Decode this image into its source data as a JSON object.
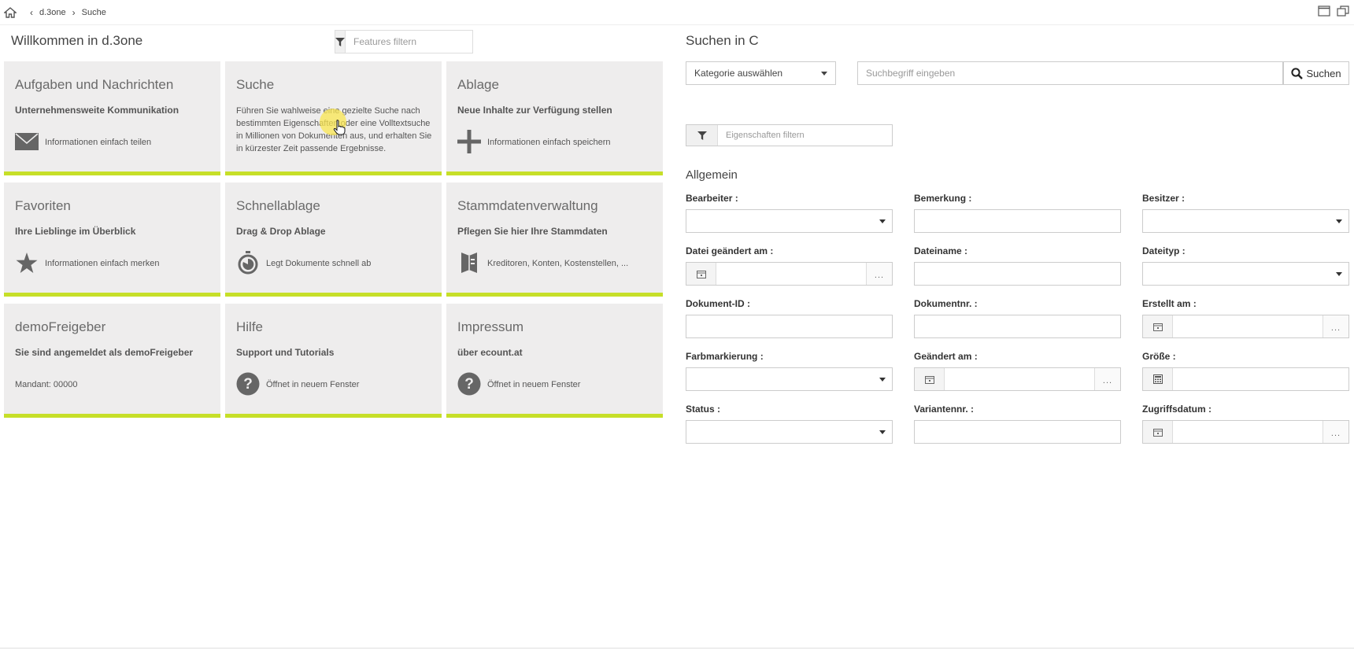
{
  "topbar": {
    "crumbs": [
      "d.3one",
      "Suche"
    ]
  },
  "left": {
    "title": "Willkommen in d.3one",
    "filter_placeholder": "Features filtern"
  },
  "tiles": [
    {
      "title": "Aufgaben und Nachrichten",
      "subtitle": "Unternehmensweite Kommunikation",
      "line": "Informationen einfach teilen",
      "icon": "envelope-icon"
    },
    {
      "title": "Suche",
      "desc": "Führen Sie wahlweise eine gezielte Suche nach bestimmten Eigenschaften oder eine Volltextsuche in Millionen von Dokumenten aus, und erhalten Sie in kürzester Zeit passende Ergebnisse."
    },
    {
      "title": "Ablage",
      "subtitle": "Neue Inhalte zur Verfügung stellen",
      "line": "Informationen einfach speichern",
      "icon": "plus-icon"
    },
    {
      "title": "Favoriten",
      "subtitle": "Ihre Lieblinge im Überblick",
      "line": "Informationen einfach merken",
      "icon": "star-icon"
    },
    {
      "title": "Schnellablage",
      "subtitle": "Drag & Drop Ablage",
      "line": "Legt Dokumente schnell ab",
      "icon": "stopwatch-icon"
    },
    {
      "title": "Stammdatenverwaltung",
      "subtitle": "Pflegen Sie hier Ihre Stammdaten",
      "line": "Kreditoren, Konten, Kostenstellen, ...",
      "icon": "book-icon"
    },
    {
      "title": "demoFreigeber",
      "subtitle": "Sie sind angemeldet als demoFreigeber",
      "line": "Mandant: 00000"
    },
    {
      "title": "Hilfe",
      "subtitle": "Support und Tutorials",
      "line": "Öffnet in neuem Fenster",
      "icon": "help-icon"
    },
    {
      "title": "Impressum",
      "subtitle": "über ecount.at",
      "line": "Öffnet in neuem Fenster",
      "icon": "help-icon"
    }
  ],
  "right": {
    "title": "Suchen in C",
    "category_select": "Kategorie auswählen",
    "search_placeholder": "Suchbegriff eingeben",
    "search_button": "Suchen",
    "props_filter_placeholder": "Eigenschaften filtern",
    "section": "Allgemein",
    "fields": [
      {
        "label": "Bearbeiter :",
        "type": "select"
      },
      {
        "label": "Bemerkung :",
        "type": "text"
      },
      {
        "label": "Besitzer :",
        "type": "select"
      },
      {
        "label": "Datei geändert am :",
        "type": "date"
      },
      {
        "label": "Dateiname :",
        "type": "text"
      },
      {
        "label": "Dateityp :",
        "type": "select"
      },
      {
        "label": "Dokument-ID :",
        "type": "text"
      },
      {
        "label": "Dokumentnr. :",
        "type": "text"
      },
      {
        "label": "Erstellt am :",
        "type": "date"
      },
      {
        "label": "Farbmarkierung :",
        "type": "select"
      },
      {
        "label": "Geändert am :",
        "type": "date"
      },
      {
        "label": "Größe :",
        "type": "number"
      },
      {
        "label": "Status :",
        "type": "select"
      },
      {
        "label": "Variantennr. :",
        "type": "text"
      },
      {
        "label": "Zugriffsdatum :",
        "type": "date"
      }
    ]
  }
}
